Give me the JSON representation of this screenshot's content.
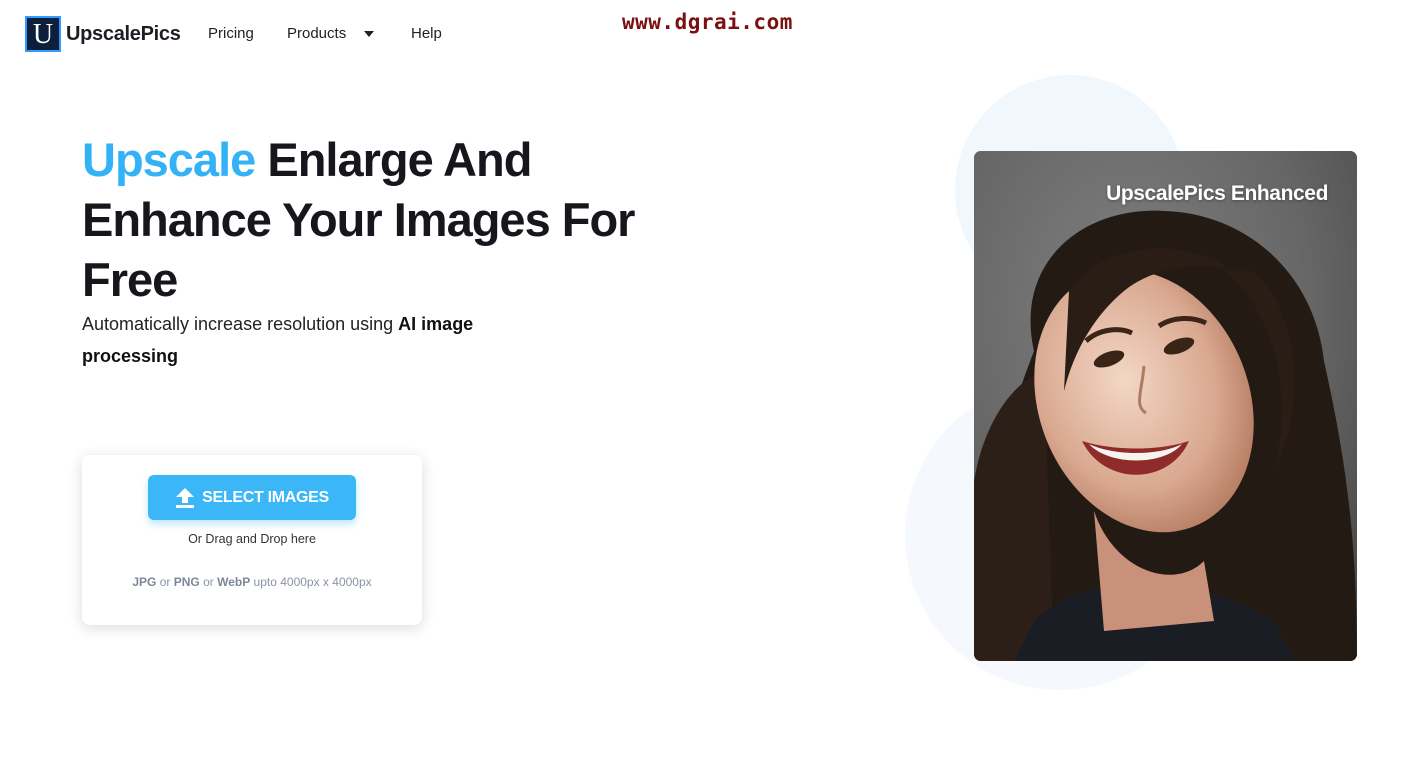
{
  "brand": {
    "logo_letter": "U",
    "name": "UpscalePics",
    "accent_color": "#33b2f5"
  },
  "nav": {
    "pricing": "Pricing",
    "products": "Products",
    "help": "Help"
  },
  "watermark": "www.dgrai.com",
  "hero": {
    "title_accent": "Upscale",
    "title_rest": " Enlarge And Enhance Your Images For Free",
    "subtitle_pre": "Automatically increase resolution using ",
    "subtitle_bold": "AI image processing"
  },
  "upload": {
    "button_label": "SELECT IMAGES",
    "button_icon": "upload-icon",
    "drag_text": "Or Drag and Drop here",
    "format_1": "JPG",
    "sep_1": " or ",
    "format_2": "PNG",
    "sep_2": " or ",
    "format_3": "WebP",
    "limit": " upto 4000px x 4000px"
  },
  "showcase": {
    "label": "UpscalePics Enhanced"
  }
}
